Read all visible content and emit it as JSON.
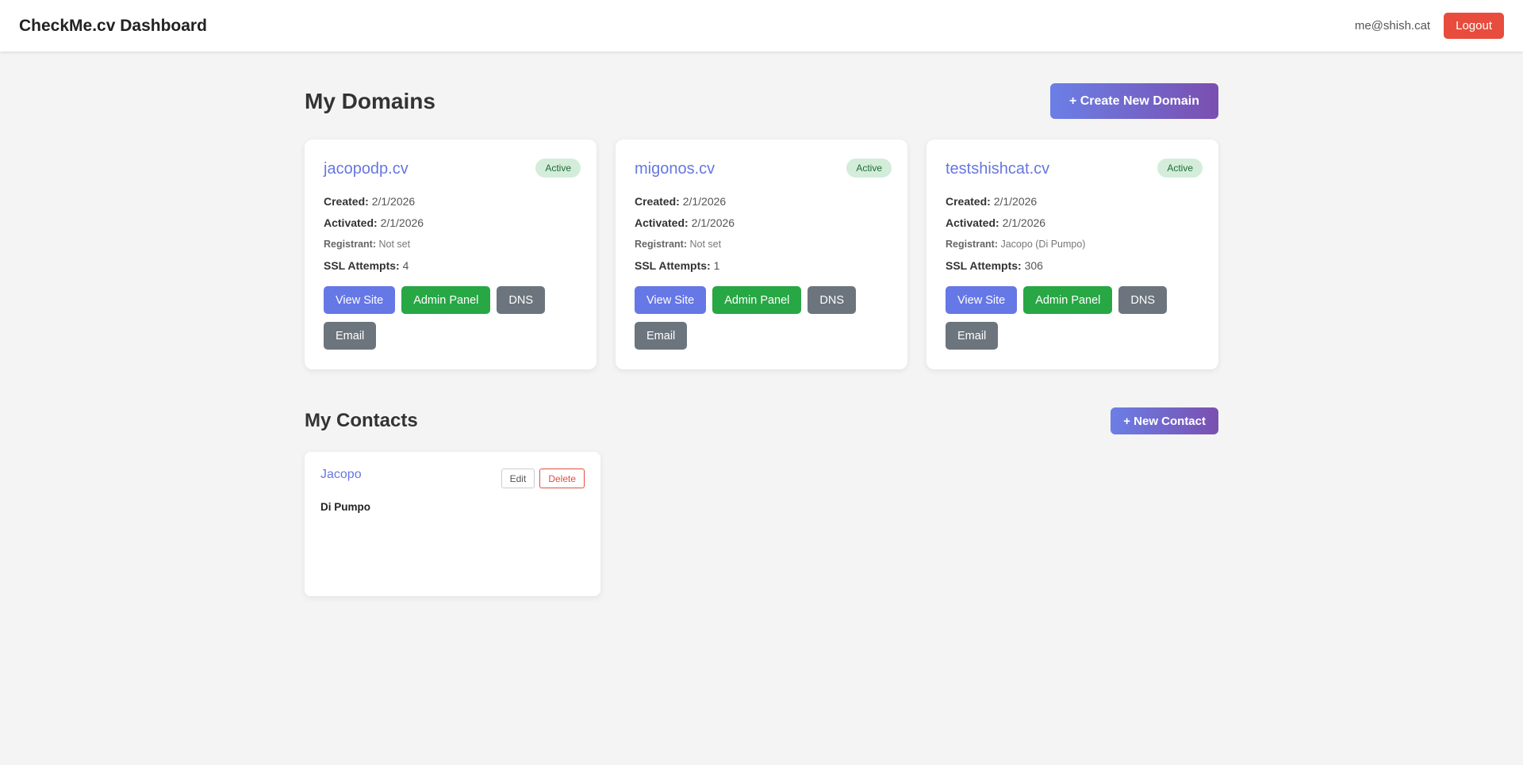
{
  "header": {
    "title": "CheckMe.cv Dashboard",
    "user_email": "me@shish.cat",
    "logout_label": "Logout"
  },
  "domains_section": {
    "title": "My Domains",
    "create_label": "+ Create New Domain"
  },
  "labels": {
    "created": "Created:",
    "activated": "Activated:",
    "registrant": "Registrant:",
    "ssl_attempts": "SSL Attempts:",
    "view_site": "View Site",
    "admin_panel": "Admin Panel",
    "dns": "DNS",
    "email": "Email"
  },
  "domains": [
    {
      "name": "jacopodp.cv",
      "status": "Active",
      "created": "2/1/2026",
      "activated": "2/1/2026",
      "registrant": "Not set",
      "ssl_attempts": "4"
    },
    {
      "name": "migonos.cv",
      "status": "Active",
      "created": "2/1/2026",
      "activated": "2/1/2026",
      "registrant": "Not set",
      "ssl_attempts": "1"
    },
    {
      "name": "testshishcat.cv",
      "status": "Active",
      "created": "2/1/2026",
      "activated": "2/1/2026",
      "registrant": "Jacopo (Di Pumpo)",
      "ssl_attempts": "306"
    }
  ],
  "contacts_section": {
    "title": "My Contacts",
    "new_label": "+ New Contact"
  },
  "contacts": [
    {
      "first_name": "Jacopo",
      "last_name": "Di Pumpo",
      "edit_label": "Edit",
      "delete_label": "Delete"
    }
  ],
  "colors": {
    "accent": "#6677e6",
    "success": "#28a745",
    "danger": "#e74c3c",
    "secondary": "#6c757d"
  }
}
